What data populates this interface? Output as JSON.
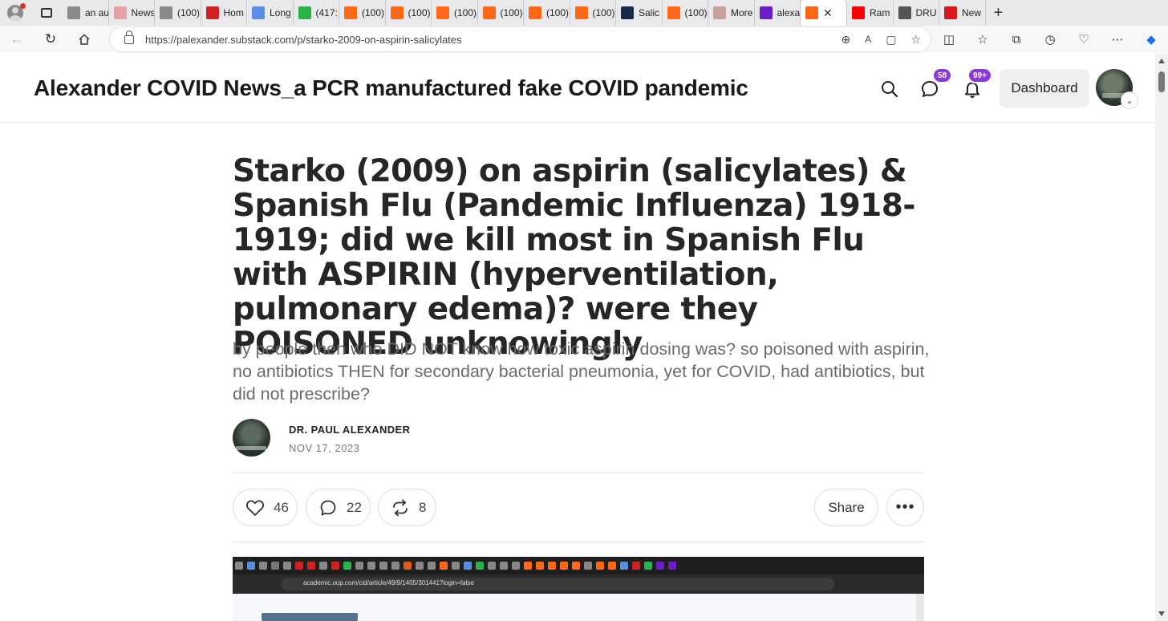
{
  "browser": {
    "tabs": [
      {
        "label": "an au",
        "icon_color": "#8a8a8a",
        "icon": "doc-icon"
      },
      {
        "label": "News",
        "icon_color": "#e8a0a0",
        "icon": "news-icon"
      },
      {
        "label": "(100)",
        "icon_color": "#8a8a8a",
        "icon": "doc-icon"
      },
      {
        "label": "Hom",
        "icon_color": "#d32020",
        "icon": "home-icon"
      },
      {
        "label": "Long",
        "icon_color": "#5b8de0",
        "icon": "long-icon"
      },
      {
        "label": "(417:",
        "icon_color": "#29b34a",
        "icon": "g-icon"
      },
      {
        "label": "(100)",
        "icon_color": "#ff6719",
        "icon": "substack-icon"
      },
      {
        "label": "(100)",
        "icon_color": "#ff6719",
        "icon": "substack-icon"
      },
      {
        "label": "(100)",
        "icon_color": "#ff6719",
        "icon": "substack-icon"
      },
      {
        "label": "(100)",
        "icon_color": "#ff6719",
        "icon": "substack-icon"
      },
      {
        "label": "(100)",
        "icon_color": "#ff6719",
        "icon": "substack-icon"
      },
      {
        "label": "(100)",
        "icon_color": "#ff6719",
        "icon": "substack-icon"
      },
      {
        "label": "Salic",
        "icon_color": "#1a2a4a",
        "icon": "oup-icon"
      },
      {
        "label": "(100)",
        "icon_color": "#ff6719",
        "icon": "substack-icon"
      },
      {
        "label": "More",
        "icon_color": "#c9a0a0",
        "icon": "bi-icon"
      },
      {
        "label": "alexa",
        "icon_color": "#6b1fc9",
        "icon": "yahoo-icon"
      }
    ],
    "active_tab": {
      "icon_color": "#ff6719",
      "icon": "substack-icon"
    },
    "tabs_after": [
      {
        "label": "Ram",
        "icon_color": "#ff0000",
        "icon": "youtube-icon"
      },
      {
        "label": "DRU",
        "icon_color": "#555555",
        "icon": "drudge-icon"
      },
      {
        "label": "New",
        "icon_color": "#d61a1a",
        "icon": "r-icon"
      }
    ],
    "url": "https://palexander.substack.com/p/starko-2009-on-aspirin-salicylates"
  },
  "site": {
    "title": "Alexander COVID News_a PCR manufactured fake COVID pandemic",
    "messages_badge": "58",
    "notifications_badge": "99+",
    "dashboard_label": "Dashboard",
    "accent_color": "#8b3ad9"
  },
  "post": {
    "title": "Starko (2009) on aspirin (salicylates) & Spanish Flu (Pandemic Influenza) 1918-1919; did we kill most in Spanish Flu with ASPIRIN (hyperventilation, pulmonary edema)? were they POISONED unknowingly",
    "subtitle": "by people then who DID NOT know how toxic aspirin dosing was? so poisoned with aspirin, no antibiotics THEN for secondary bacterial pneumonia, yet for COVID, had antibiotics, but did not prescribe?",
    "author": "DR. PAUL ALEXANDER",
    "date": "NOV 17, 2023",
    "likes": "46",
    "comments": "22",
    "restacks": "8",
    "share_label": "Share"
  },
  "embed": {
    "url": "academic.oup.com/cid/article/49/9/1405/301441?login=false"
  }
}
